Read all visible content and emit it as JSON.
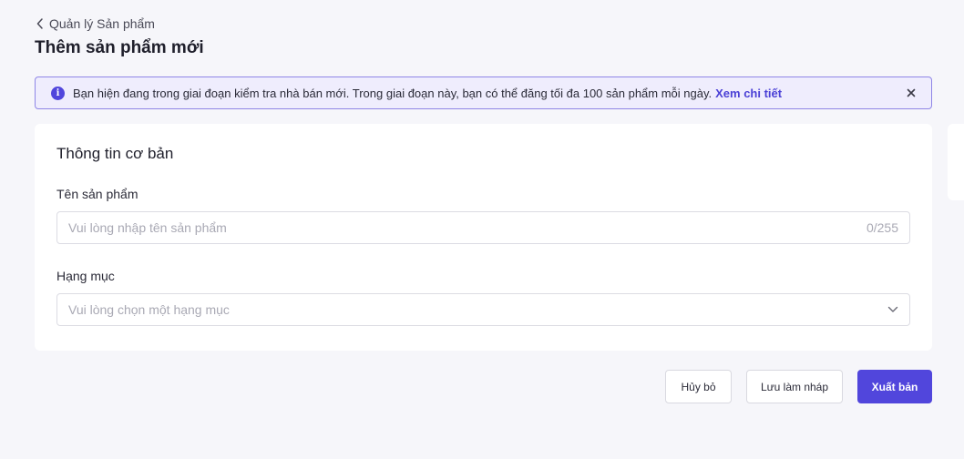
{
  "breadcrumb": {
    "label": "Quản lý Sản phẩm",
    "icon": "chevron-left-icon"
  },
  "page": {
    "title": "Thêm sản phẩm mới"
  },
  "notice": {
    "icon": "info-icon",
    "icon_glyph": "i",
    "message": "Bạn hiện đang trong giai đoạn kiểm tra nhà bán mới. Trong giai đoạn này, bạn có thể đăng tối đa 100 sản phẩm mỗi ngày.",
    "link": "Xem chi tiết",
    "close_icon": "close-icon"
  },
  "basic_info": {
    "title": "Thông tin cơ bản",
    "product_name": {
      "label": "Tên sản phẩm",
      "placeholder": "Vui lòng nhập tên sản phẩm",
      "value": "",
      "counter": "0/255"
    },
    "category": {
      "label": "Hạng mục",
      "placeholder": "Vui lòng chọn một hạng mục",
      "icon": "chevron-down-icon"
    }
  },
  "actions": {
    "cancel": "Hủy bỏ",
    "save_draft": "Lưu làm nháp",
    "publish": "Xuất bản"
  },
  "colors": {
    "accent": "#5146dc",
    "notice_bg": "#efedfd",
    "notice_border": "#8f86e6",
    "page_bg": "#f6f6fa"
  }
}
